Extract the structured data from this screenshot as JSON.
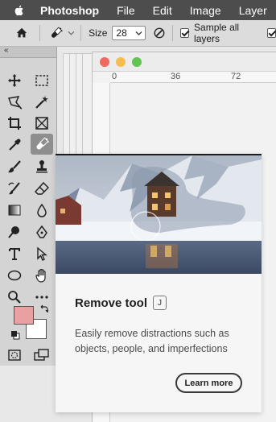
{
  "menubar": {
    "app_name": "Photoshop",
    "items": [
      "File",
      "Edit",
      "Image",
      "Layer"
    ]
  },
  "options_bar": {
    "size_label": "Size",
    "size_value": "28",
    "sample_all_layers_label": "Sample all layers"
  },
  "toolbar": {
    "collapse_glyph": "«",
    "selected_tool": "remove-tool",
    "foreground_color": "#e8a0a0",
    "background_color": "#ffffff"
  },
  "document": {
    "ruler_marks": [
      "0",
      "36",
      "72"
    ]
  },
  "tooltip": {
    "title": "Remove tool",
    "shortcut": "J",
    "description": "Easily remove distractions such as objects, people, and imperfections",
    "learn_more_label": "Learn more"
  }
}
